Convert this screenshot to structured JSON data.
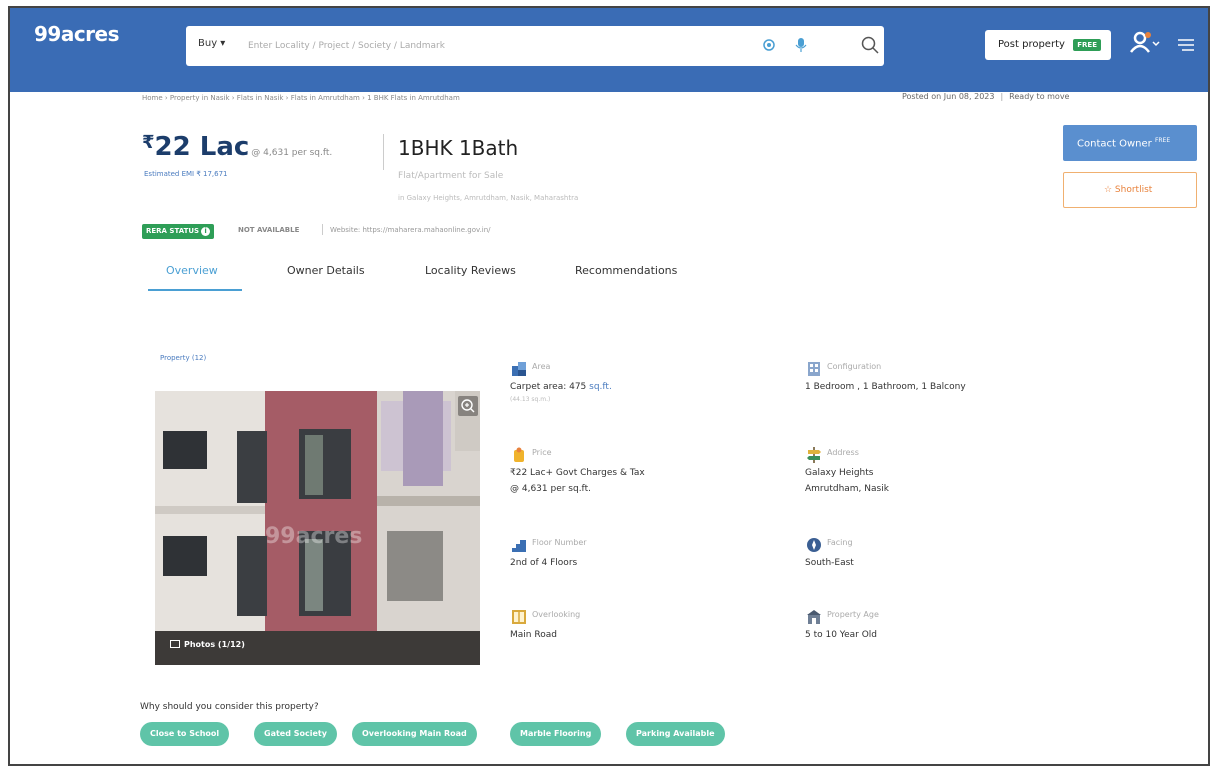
{
  "header": {
    "logo": "99acres",
    "buy_label": "Buy ▾",
    "search_placeholder": "Enter Locality / Project / Society / Landmark",
    "post_property_label": "Post property",
    "free_tag": "FREE"
  },
  "breadcrumb": "Home › Property in Nasik › Flats in Nasik › Flats in Amrutdham › 1 BHK Flats in Amrutdham",
  "posted": {
    "date": "Posted on Jun 08, 2023",
    "status": "Ready to move"
  },
  "price": {
    "currency": "₹",
    "amount": "22 Lac",
    "per_sqft": "@ 4,631 per sq.ft.",
    "emi": "Estimated EMI ₹ 17,671"
  },
  "listing": {
    "bhk_title": "1BHK 1Bath",
    "subtype": "Flat/Apartment for Sale",
    "address": "in Galaxy Heights, Amrutdham, Nasik, Maharashtra"
  },
  "actions": {
    "contact_owner": "Contact Owner",
    "contact_free": "FREE",
    "shortlist": "☆ Shortlist"
  },
  "rera": {
    "badge": "RERA STATUS",
    "status": "NOT AVAILABLE",
    "website": "Website: https://maharera.mahaonline.gov.in/"
  },
  "tabs": [
    "Overview",
    "Owner Details",
    "Locality Reviews",
    "Recommendations"
  ],
  "photos": {
    "label": "Property (12)",
    "count": "Photos (1/12)",
    "watermark": "99acres"
  },
  "details": {
    "area": {
      "label": "Area",
      "value_prefix": "Carpet area: 475",
      "unit": "sq.ft.",
      "sub": "(44.13 sq.m.)"
    },
    "configuration": {
      "label": "Configuration",
      "value": "1 Bedroom , 1 Bathroom, 1 Balcony"
    },
    "price": {
      "label": "Price",
      "value": "₹22 Lac+ Govt Charges & Tax",
      "value2": "@ 4,631 per sq.ft."
    },
    "address": {
      "label": "Address",
      "value": "Galaxy Heights",
      "value2": "Amrutdham, Nasik"
    },
    "floor": {
      "label": "Floor Number",
      "value": "2nd  of 4 Floors"
    },
    "facing": {
      "label": "Facing",
      "value": "South-East"
    },
    "overlooking": {
      "label": "Overlooking",
      "value": "Main Road"
    },
    "age": {
      "label": "Property Age",
      "value": "5 to 10 Year Old"
    }
  },
  "why": {
    "title": "Why should you consider this property?",
    "chips": [
      "Close to School",
      "Gated Society",
      "Overlooking Main Road",
      "Marble Flooring",
      "Parking Available"
    ]
  },
  "colors": {
    "brand_blue": "#3a6cb5",
    "accent_blue": "#4a9fd3",
    "green": "#2e9e57",
    "chip_green": "#5fc4a8",
    "orange": "#e8823c"
  }
}
